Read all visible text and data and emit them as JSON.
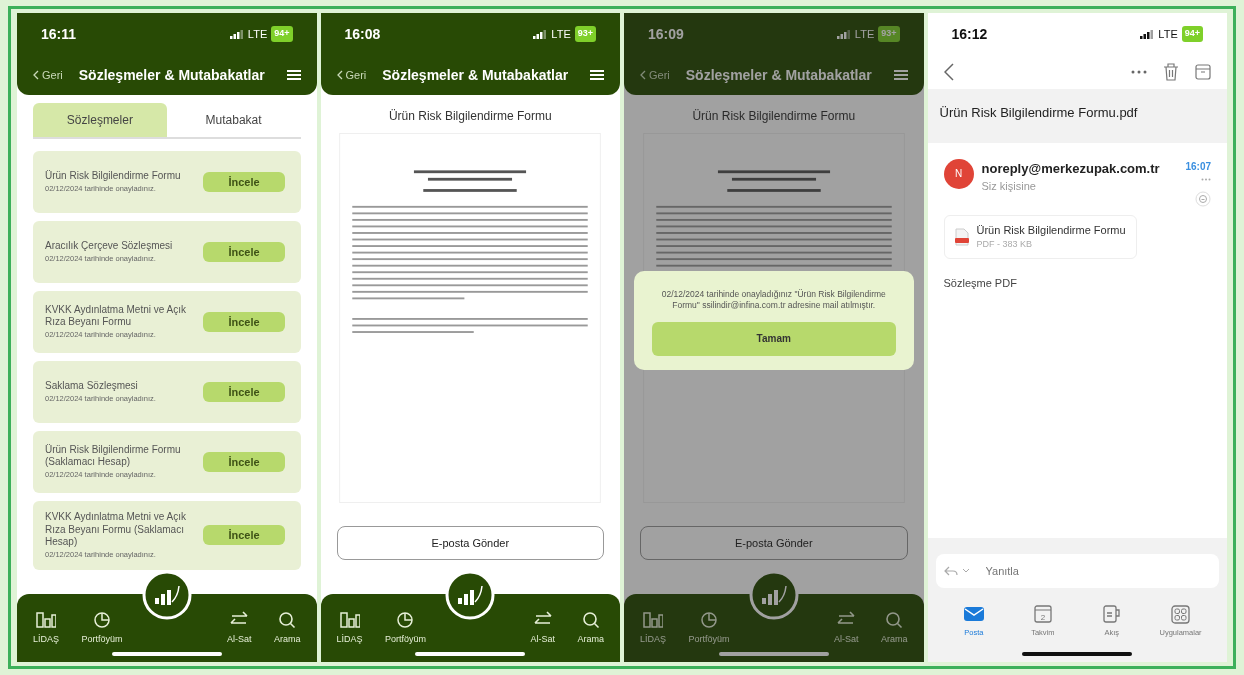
{
  "screens": [
    {
      "kind": "contracts",
      "status": {
        "time": "16:11",
        "network": "LTE",
        "battery": "94+"
      },
      "header": {
        "back": "Geri",
        "title": "Sözleşmeler & Mutabakatlar"
      },
      "tabs": [
        {
          "label": "Sözleşmeler",
          "selected": true
        },
        {
          "label": "Mutabakat",
          "selected": false
        }
      ],
      "items": [
        {
          "title": "Ürün Risk Bilgilendirme Formu",
          "date": "02/12/2024 tarihinde onayladınız.",
          "button": "İncele"
        },
        {
          "title": "Aracılık Çerçeve Sözleşmesi",
          "date": "02/12/2024 tarihinde onayladınız.",
          "button": "İncele"
        },
        {
          "title": "KVKK Aydınlatma Metni ve Açık Rıza Beyanı Formu",
          "date": "02/12/2024 tarihinde onayladınız.",
          "button": "İncele"
        },
        {
          "title": "Saklama Sözleşmesi",
          "date": "02/12/2024 tarihinde onayladınız.",
          "button": "İncele"
        },
        {
          "title": "Ürün Risk Bilgilendirme Formu (Saklamacı Hesap)",
          "date": "02/12/2024 tarihinde onayladınız.",
          "button": "İncele"
        },
        {
          "title": "KVKK Aydınlatma Metni ve Açık Rıza Beyanı Formu (Saklamacı Hesap)",
          "date": "02/12/2024 tarihinde onayladınız.",
          "button": "İncele"
        }
      ],
      "nav": [
        {
          "kind": "chart",
          "label": "LİDAŞ"
        },
        {
          "kind": "pie",
          "label": "Portföyüm"
        },
        {
          "kind": "arrows",
          "label": "Al-Sat"
        },
        {
          "kind": "search",
          "label": "Arama"
        }
      ]
    },
    {
      "kind": "document",
      "status": {
        "time": "16:08",
        "network": "LTE",
        "battery": "93+"
      },
      "header": {
        "back": "Geri",
        "title": "Sözleşmeler & Mutabakatlar"
      },
      "doc_title": "Ürün Risk Bilgilendirme Formu",
      "send_button": "E-posta Gönder",
      "nav": [
        {
          "kind": "chart",
          "label": "LİDAŞ"
        },
        {
          "kind": "pie",
          "label": "Portföyüm"
        },
        {
          "kind": "arrows",
          "label": "Al-Sat"
        },
        {
          "kind": "search",
          "label": "Arama"
        }
      ]
    },
    {
      "kind": "document",
      "status": {
        "time": "16:09",
        "network": "LTE",
        "battery": "93+"
      },
      "header": {
        "back": "Geri",
        "title": "Sözleşmeler & Mutabakatlar"
      },
      "doc_title": "Ürün Risk Bilgilendirme Formu",
      "send_button": "E-posta Gönder",
      "dialog": {
        "message": "02/12/2024 tarihinde onayladığınız \"Ürün Risk Bilgilendirme Formu\" ssilindir@infina.com.tr adresine mail atılmıştır.",
        "button": "Tamam"
      },
      "nav": [
        {
          "kind": "chart",
          "label": "LİDAŞ"
        },
        {
          "kind": "pie",
          "label": "Portföyüm"
        },
        {
          "kind": "arrows",
          "label": "Al-Sat"
        },
        {
          "kind": "search",
          "label": "Arama"
        }
      ]
    },
    {
      "kind": "mail",
      "status": {
        "time": "16:12",
        "network": "LTE",
        "battery": "94+"
      },
      "subject": "Ürün Risk Bilgilendirme Formu.pdf",
      "sender": {
        "initial": "N",
        "email": "noreply@merkezupak.com.tr",
        "to": "Siz kişisine",
        "time": "16:07"
      },
      "attachment": {
        "name": "Ürün Risk Bilgilendirme Formu",
        "meta": "PDF - 383 KB"
      },
      "body": "Sözleşme PDF",
      "reply": {
        "placeholder": "Yanıtla"
      },
      "tabs": [
        {
          "kind": "mail",
          "label": "Posta",
          "selected": true
        },
        {
          "kind": "calendar",
          "label": "Takvim",
          "icon_text": "2",
          "selected": false
        },
        {
          "kind": "feed",
          "label": "Akış",
          "selected": false
        },
        {
          "kind": "apps",
          "label": "Uygulamalar",
          "selected": false
        }
      ]
    }
  ]
}
